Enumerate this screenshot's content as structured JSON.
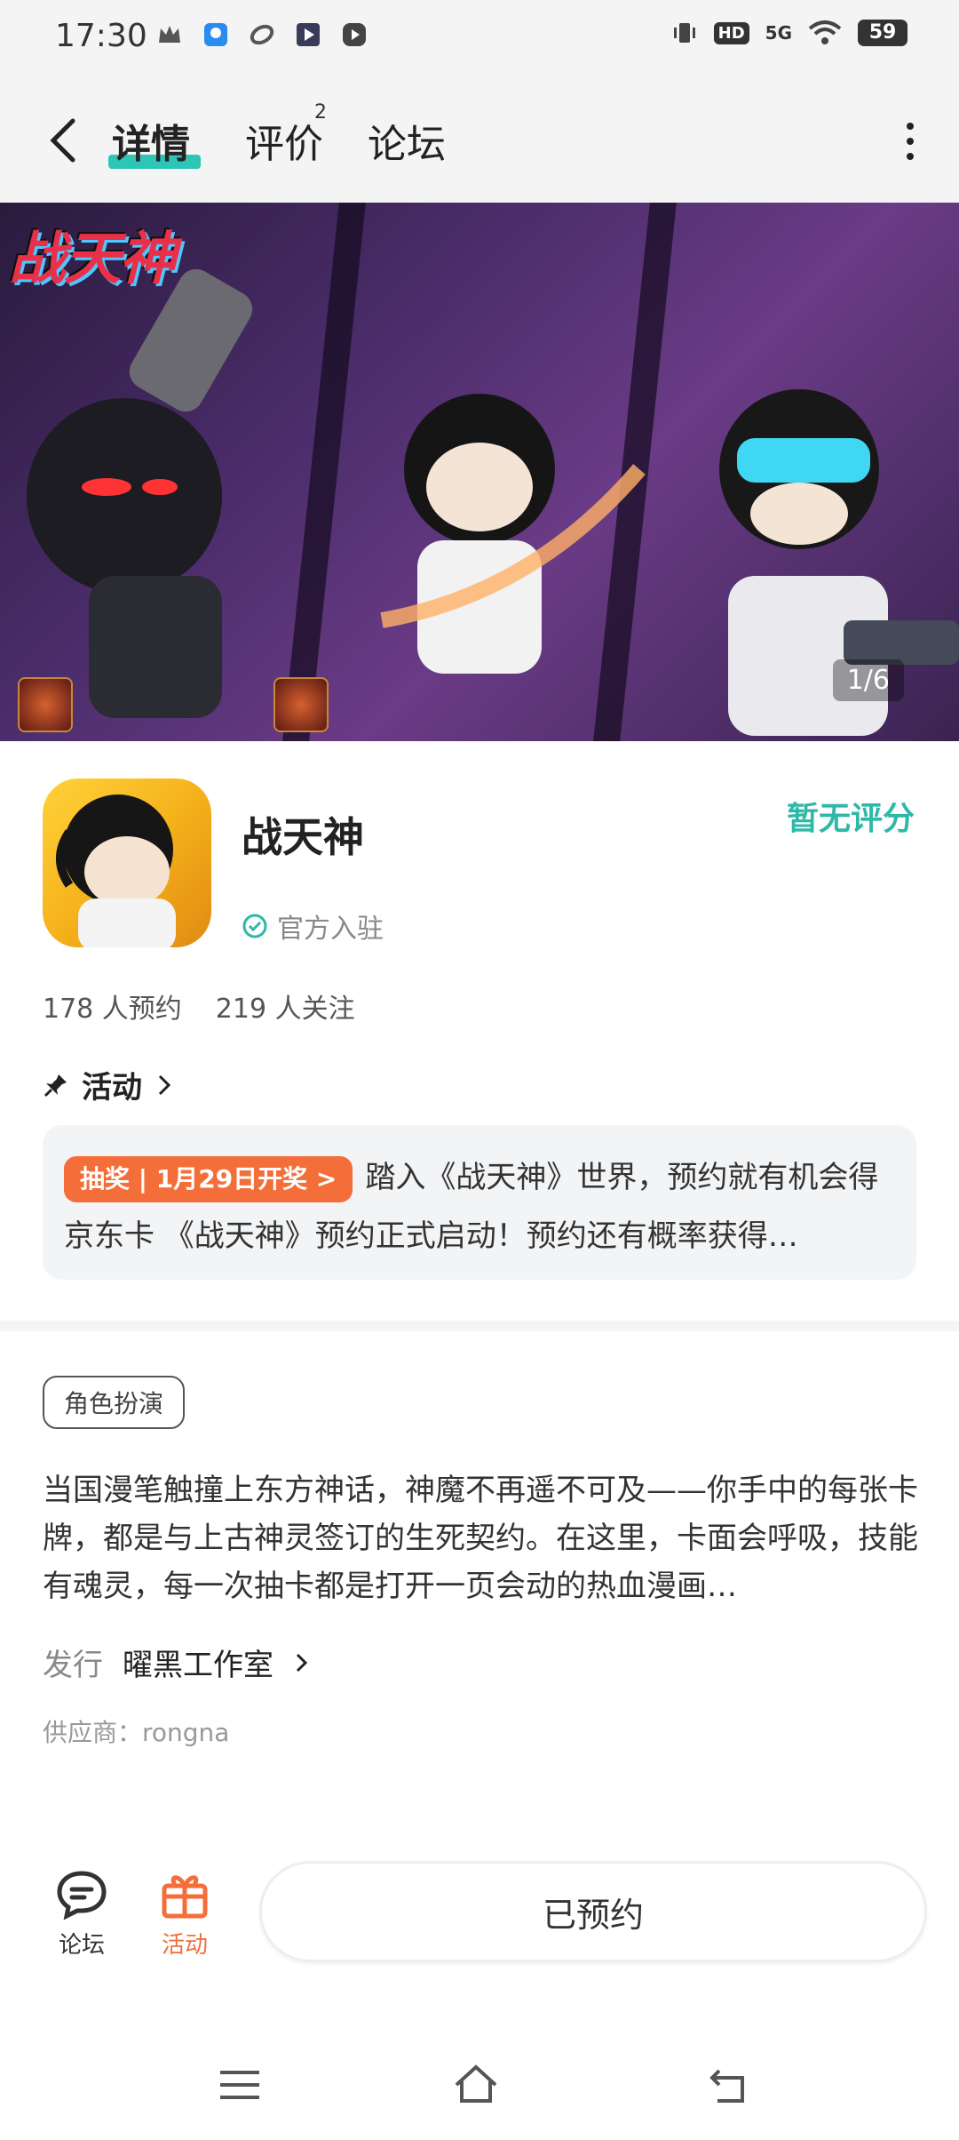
{
  "status_bar": {
    "time": "17:30",
    "hd": "HD",
    "network": "5G",
    "battery": "59"
  },
  "nav": {
    "tabs": [
      {
        "label": "详情",
        "active": true
      },
      {
        "label": "评价",
        "badge": "2"
      },
      {
        "label": "论坛"
      }
    ]
  },
  "banner": {
    "logo_text": "战天神",
    "counter": "1/6"
  },
  "app": {
    "name": "战天神",
    "rating": "暂无评分",
    "official": "官方入驻",
    "reservations": "178 人预约",
    "followers": "219 人关注"
  },
  "activity": {
    "heading": "活动",
    "badge": "抽奖 | 1月29日开奖 >",
    "text": "踏入《战天神》世界，预约就有机会得京东卡 《战天神》预约正式启动！预约还有概率获得…"
  },
  "details": {
    "genre": "角色扮演",
    "description": "当国漫笔触撞上东方神话，神魔不再遥不可及——你手中的每张卡牌，都是与上古神灵签订的生死契约。在这里，卡面会呼吸，技能有魂灵，每一次抽卡都是打开一页会动的热血漫画…",
    "publisher_label": "发行",
    "publisher_name": "曜黑工作室",
    "supplier": "供应商：rongna"
  },
  "bottom_bar": {
    "forum_label": "论坛",
    "activity_label": "活动",
    "reserve_label": "已预约"
  },
  "colors": {
    "accent": "#2ec5b6",
    "rating": "#2eb8a8",
    "promo": "#f46e3a"
  }
}
